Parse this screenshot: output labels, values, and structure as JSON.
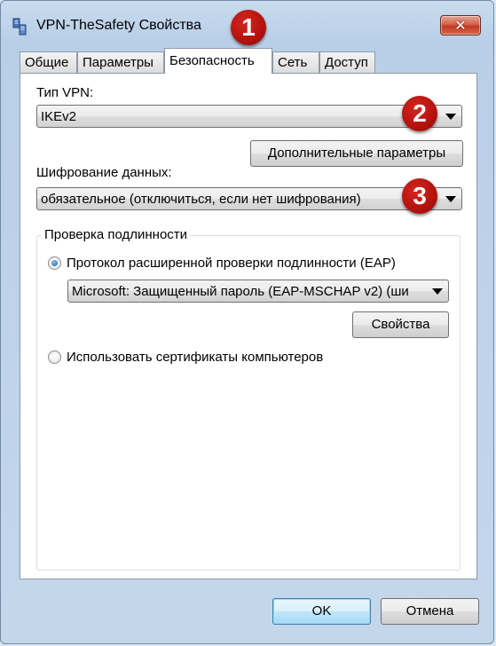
{
  "window": {
    "title": "VPN-TheSafety Свойства",
    "close_symbol": "✕"
  },
  "tabs": [
    {
      "label": "Общие"
    },
    {
      "label": "Параметры"
    },
    {
      "label": "Безопасность",
      "active": true
    },
    {
      "label": "Сеть"
    },
    {
      "label": "Доступ"
    }
  ],
  "security": {
    "vpn_type_label": "Тип VPN:",
    "vpn_type_value": "IKEv2",
    "advanced_button": "Дополнительные параметры",
    "encryption_label": "Шифрование данных:",
    "encryption_value": "обязательное (отключиться, если нет шифрования)",
    "auth_group_title": "Проверка подлинности",
    "eap_radio_label": "Протокол расширенной проверки подлинности (EAP)",
    "eap_method_value": "Microsoft: Защищенный пароль (EAP-MSCHAP v2) (ши",
    "properties_button": "Свойства",
    "cert_radio_label": "Использовать сертификаты компьютеров"
  },
  "footer": {
    "ok_button": "OK",
    "cancel_button": "Отмена"
  },
  "annotations": [
    "1",
    "2",
    "3"
  ],
  "colors": {
    "badge": "#b3120e",
    "close_button": "#c23b21",
    "window_frame": "#b9cfe7"
  }
}
